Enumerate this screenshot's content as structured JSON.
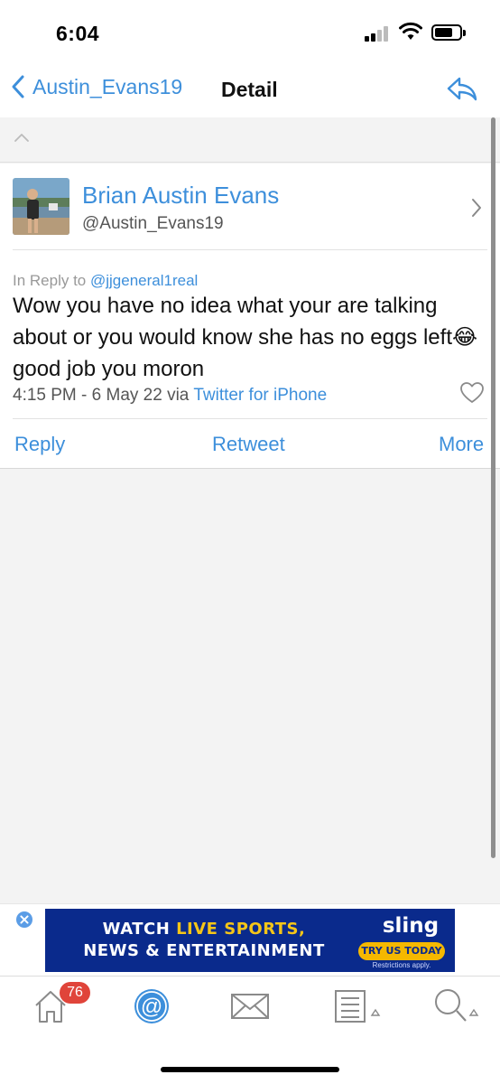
{
  "status_bar": {
    "time": "6:04"
  },
  "nav": {
    "back_label": "Austin_Evans19",
    "title": "Detail"
  },
  "tweet": {
    "display_name": "Brian Austin Evans",
    "handle": "@Austin_Evans19",
    "reply_prefix": "In Reply to",
    "reply_handle": "@jjgeneral1real",
    "text": "Wow you have no idea what your are talking about or you would know she has no eggs left😂 good job you moron",
    "timestamp": "4:15 PM - 6 May 22 via",
    "client": "Twitter for iPhone"
  },
  "actions": {
    "reply": "Reply",
    "retweet": "Retweet",
    "more": "More"
  },
  "ad": {
    "line1_prefix": "WATCH",
    "line1_accent": "LIVE SPORTS,",
    "line2": "NEWS & ENTERTAINMENT",
    "brand": "sling",
    "cta": "TRY US TODAY",
    "disclaimer": "Restrictions apply."
  },
  "tab_bar": {
    "home_badge": "76"
  },
  "colors": {
    "accent": "#3d8fdb",
    "badge": "#e0443a",
    "ad_background": "#0a2a8c",
    "ad_highlight": "#f5c518"
  }
}
